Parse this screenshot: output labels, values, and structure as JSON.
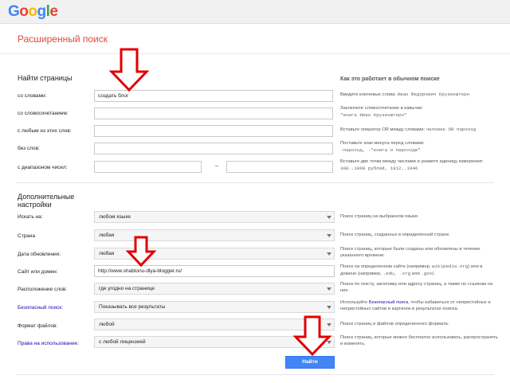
{
  "header": {
    "logo_letters": [
      {
        "char": "G",
        "color": "#4285F4"
      },
      {
        "char": "o",
        "color": "#EA4335"
      },
      {
        "char": "o",
        "color": "#FBBC05"
      },
      {
        "char": "g",
        "color": "#4285F4"
      },
      {
        "char": "l",
        "color": "#34A853"
      },
      {
        "char": "e",
        "color": "#EA4335"
      }
    ],
    "page_title": "Расширенный поиск"
  },
  "find_section": {
    "title": "Найти страницы",
    "hint_title": "Как это работает в обычном поиске",
    "rows": [
      {
        "label": "со словами:",
        "value": "создать блог",
        "hint": "Введите ключевые слова:",
        "hint_example": "Иван Федорович Крузенштерн"
      },
      {
        "label": "со словосочетанием:",
        "value": "",
        "hint": "Заключите словосочетание в кавычки:",
        "hint_example": "\"книга Иван Крузенштерн\""
      },
      {
        "label": "с любым из этих слов:",
        "value": "",
        "hint": "Вставьте оператор OR между словами:",
        "hint_example": "человек OR пароход"
      },
      {
        "label": "без слов:",
        "value": "",
        "hint": "Поставьте знак минуса перед словами:",
        "hint_example": "-пароход, -\"книга о пароходе\""
      },
      {
        "label": "с диапазоном чисел:",
        "value_from": "",
        "value_to": "",
        "dash": "–",
        "hint": "Вставьте две точки между числами и укажите единицу измерения:",
        "hint_example": "300..1000 рублей, 1812..1846"
      }
    ]
  },
  "refine_section": {
    "title_line1": "Дополнительные",
    "title_line2": "настройки",
    "rows": [
      {
        "label": "Искать на:",
        "value": "любом языке",
        "hint": "Поиск страниц на выбранном языке."
      },
      {
        "label": "Страна",
        "value": "любая",
        "hint": "Поиск страниц, созданных в определенной стране."
      },
      {
        "label": "Дата обновления:",
        "value": "любая",
        "hint": "Поиск страниц, которые были созданы или обновлены в течение указанного времени."
      },
      {
        "label": "Сайт или домен:",
        "value": "http://www.shablonu-dlya-blogger.ru/",
        "hint": "Поиск на определенном сайте (например,",
        "hint_mono1": "wikipedia.org",
        "hint_mid": ") или в домене (например,",
        "hint_mono2": ".edu, .org",
        "hint_mid2": "или",
        "hint_mono3": ".gov",
        "hint_end": ")."
      },
      {
        "label": "Расположение слов:",
        "value": "где угодно на странице",
        "hint": "Поиск по тексту, заголовку или адресу страниц, а также по ссылкам на них."
      },
      {
        "label": "Безопасный поиск:",
        "value": "Показывать все результаты",
        "hint_pre": "Используйте",
        "hint_link": "Безопасный поиск",
        "hint": ", чтобы избавиться от непристойных и непристойных сайтов и картинок в результатах поиска."
      },
      {
        "label": "Формат файлов:",
        "value": "любой",
        "hint": "Поиск страниц и файлов определенного формата."
      },
      {
        "label": "Права на использование:",
        "value": "с любой лицензией",
        "hint": "Поиск страниц, которые можно бесплатно использовать, распространять и изменять."
      }
    ],
    "submit_label": "Найти"
  },
  "colors": {
    "accent_red": "#dd4b39",
    "button_blue": "#4285f4",
    "arrow_red": "#e00000",
    "link": "#1a0dab"
  }
}
